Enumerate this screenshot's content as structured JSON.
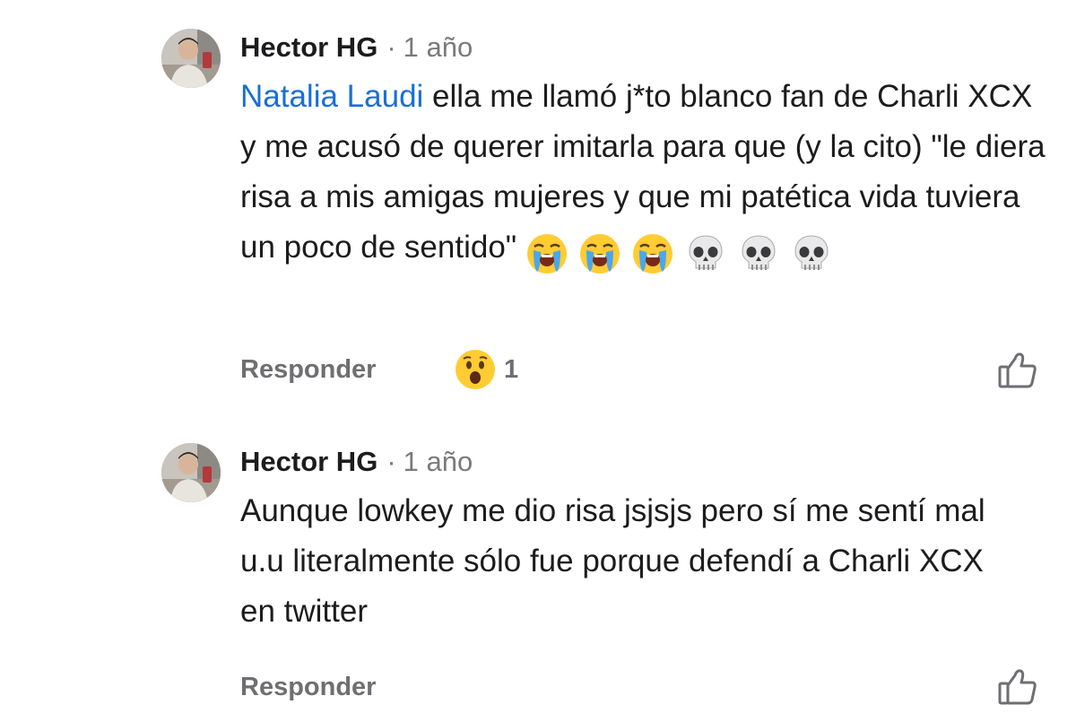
{
  "comments": [
    {
      "author": "Hector HG",
      "separator": "·",
      "time": "1 año",
      "mention": "Natalia Laudi",
      "text": " ella me llamó j*to blanco fan de Charli XCX y me acusó de querer imitarla para que (y la cito) \"le diera risa a mis amigas mujeres y que mi patética vida tuviera un poco de sentido\" ",
      "emojis": [
        "loudly-crying-face",
        "loudly-crying-face",
        "loudly-crying-face",
        "skull",
        "skull",
        "skull"
      ],
      "reply_label": "Responder",
      "reaction": {
        "emoji": "face-with-open-mouth",
        "count": "1"
      },
      "like_icon": "thumbs-up-outline-icon"
    },
    {
      "author": "Hector HG",
      "separator": "·",
      "time": "1 año",
      "text": "Aunque lowkey me dio risa jsjsjs pero sí me sentí mal u.u literalmente sólo fue porque defendí a Charli XCX en twitter",
      "reply_label": "Responder",
      "like_icon": "thumbs-up-outline-icon"
    }
  ],
  "colors": {
    "mention": "#1a6fd4",
    "secondary_text": "#6e6e73",
    "primary_text": "#1c1c1e",
    "background": "#ffffff"
  }
}
